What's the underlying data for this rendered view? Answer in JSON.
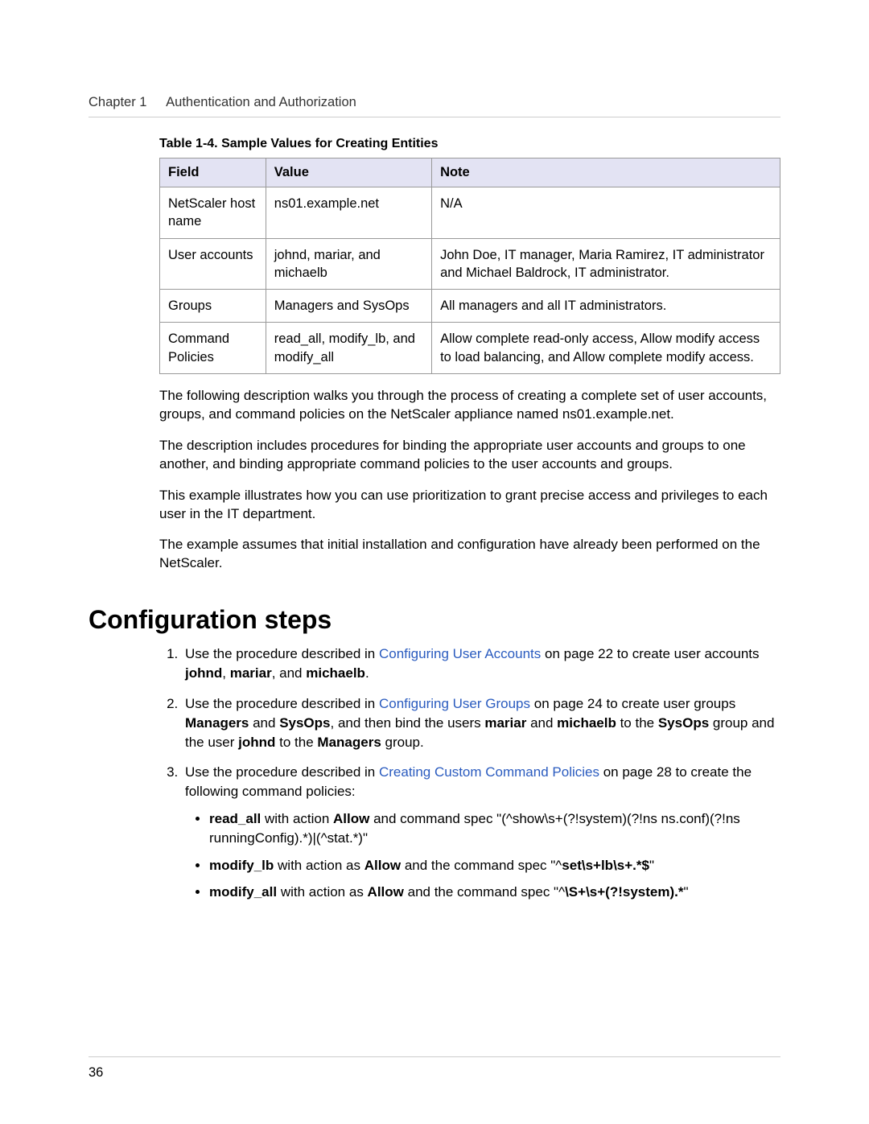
{
  "header": {
    "chapter_label": "Chapter 1",
    "chapter_title": "Authentication and Authorization"
  },
  "table": {
    "caption": "Table 1-4. Sample Values for Creating Entities",
    "headers": {
      "field": "Field",
      "value": "Value",
      "note": "Note"
    },
    "rows": [
      {
        "field": "NetScaler host name",
        "value": "ns01.example.net",
        "note": "N/A"
      },
      {
        "field": "User accounts",
        "value": "johnd, mariar, and michaelb",
        "note": "John Doe, IT manager, Maria Ramirez, IT administrator and Michael Baldrock, IT administrator."
      },
      {
        "field": "Groups",
        "value": "Managers and SysOps",
        "note": "All managers and all IT administrators."
      },
      {
        "field": "Command Policies",
        "value": "read_all, modify_lb, and modify_all",
        "note": "Allow complete read-only access, Allow modify access to load balancing, and Allow complete modify access."
      }
    ]
  },
  "paragraphs": {
    "p1": "The following description walks you through the process of creating a complete set of user accounts, groups, and command policies on the NetScaler appliance named ns01.example.net.",
    "p2": "The description includes procedures for binding the appropriate user accounts and groups to one another, and binding appropriate command policies to the user accounts and groups.",
    "p3": "This example illustrates how you can use prioritization to grant precise access and privileges to each user in the IT department.",
    "p4": "The example assumes that initial installation and configuration have already been performed on the NetScaler."
  },
  "section_title": "Configuration steps",
  "steps": {
    "s1": {
      "pre": "Use the procedure described in  ",
      "link": "Configuring User Accounts",
      "post1": " on page 22 to create user accounts ",
      "b1": "johnd",
      "sep1": ", ",
      "b2": "mariar",
      "sep2": ", and ",
      "b3": "michaelb",
      "end": "."
    },
    "s2": {
      "pre": "Use the procedure described in ",
      "link": "Configuring User Groups",
      "post1": " on page 24 to create user groups ",
      "b1": "Managers",
      "sep1": " and ",
      "b2": "SysOps",
      "post2": ", and then bind the users ",
      "b3": "mariar",
      "sep2": " and ",
      "b4": "michaelb",
      "post3": " to the ",
      "b5": "SysOps",
      "post4": " group and the user ",
      "b6": "johnd",
      "post5": " to the ",
      "b7": "Managers",
      "end": " group."
    },
    "s3": {
      "pre": "Use the procedure described in ",
      "link": "Creating Custom Command Policies",
      "post": " on page 28 to create the following command policies:"
    },
    "bullets": {
      "b1": {
        "name": "read_all",
        "t1": " with action ",
        "action": "Allow",
        "t2": " and command spec \"(^show\\s+(?!system)(?!ns ns.conf)(?!ns runningConfig).*)|(^stat.*)\""
      },
      "b2": {
        "name": "modify_lb",
        "t1": " with action as ",
        "action": "Allow",
        "t2": " and the command spec \"^",
        "spec": "set\\s+lb\\s+.*$",
        "t3": "\""
      },
      "b3": {
        "name": "modify_all",
        "t1": " with action as ",
        "action": "Allow",
        "t2": " and the command spec \"^",
        "spec": "\\S+\\s+(?!system).*",
        "t3": "\""
      }
    }
  },
  "footer": {
    "page_number": "36"
  }
}
